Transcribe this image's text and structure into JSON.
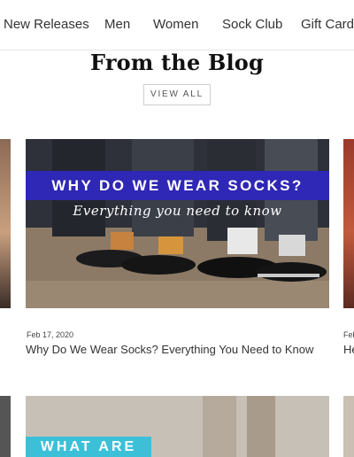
{
  "nav": {
    "items": [
      "New Releases",
      "Men",
      "Women",
      "Sock Club",
      "Gift Card"
    ]
  },
  "blog_section": {
    "title": "From the Blog",
    "view_all_label": "VIEW ALL"
  },
  "posts": [
    {
      "image_banner": "WHY DO WE WEAR SOCKS?",
      "image_subtitle": "Everything you need to know",
      "date": "Feb 17, 2020",
      "title": "Why Do We Wear Socks? Everything You Need to Know"
    },
    {
      "image_banner": "WHAT ARE"
    }
  ],
  "right_post": {
    "date": "Feb",
    "title": "He"
  },
  "colors": {
    "banner_blue": "#2f27b5",
    "banner_cyan": "#3cc0d8"
  }
}
